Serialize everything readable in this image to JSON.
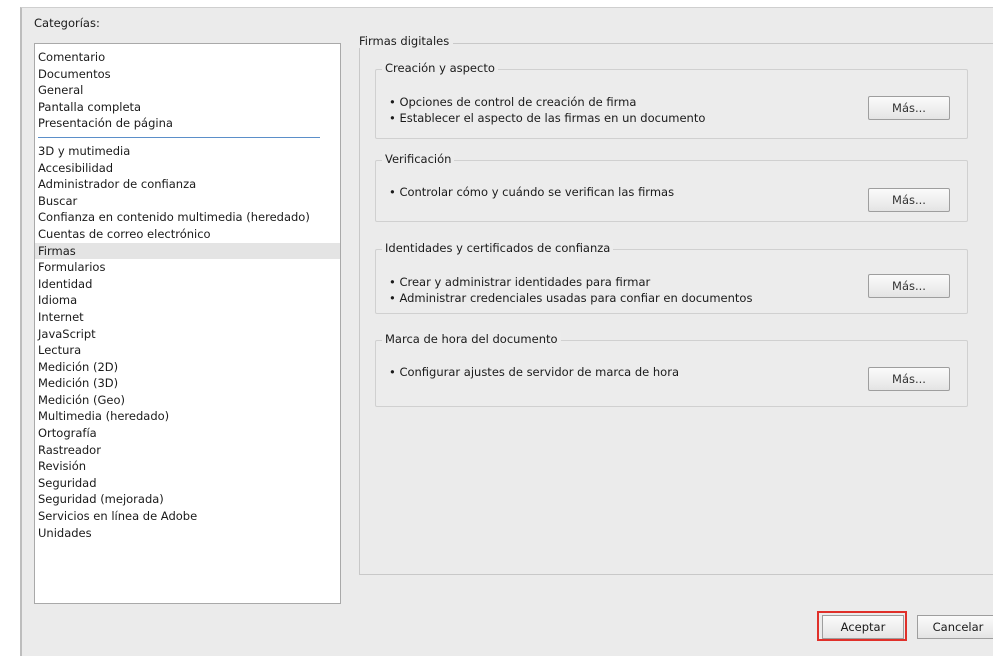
{
  "categories_label": "Categorías:",
  "categories_group1": [
    "Comentario",
    "Documentos",
    "General",
    "Pantalla completa",
    "Presentación de página"
  ],
  "categories_group2": [
    "3D y mutimedia",
    "Accesibilidad",
    "Administrador de confianza",
    "Buscar",
    "Confianza en contenido multimedia (heredado)",
    "Cuentas de correo electrónico",
    "Firmas",
    "Formularios",
    "Identidad",
    "Idioma",
    "Internet",
    "JavaScript",
    "Lectura",
    "Medición (2D)",
    "Medición (3D)",
    "Medición (Geo)",
    "Multimedia (heredado)",
    "Ortografía",
    "Rastreador",
    "Revisión",
    "Seguridad",
    "Seguridad (mejorada)",
    "Servicios en línea de Adobe",
    "Unidades"
  ],
  "selected_category": "Firmas",
  "panel_title": "Firmas digitales",
  "groups": [
    {
      "title": "Creación y aspecto",
      "bullets": [
        "• Opciones de control de creación de firma",
        "• Establecer el aspecto de las firmas en un documento"
      ],
      "button": "Más..."
    },
    {
      "title": "Verificación",
      "bullets": [
        "• Controlar cómo y cuándo se verifican las firmas"
      ],
      "button": "Más..."
    },
    {
      "title": "Identidades y certificados de confianza",
      "bullets": [
        "• Crear y administrar identidades para firmar",
        "• Administrar credenciales usadas para confiar en documentos"
      ],
      "button": "Más..."
    },
    {
      "title": "Marca de hora del documento",
      "bullets": [
        "• Configurar ajustes de servidor de marca de hora"
      ],
      "button": "Más..."
    }
  ],
  "footer": {
    "accept": "Aceptar",
    "cancel": "Cancelar"
  },
  "colors": {
    "highlight": "#e0302a",
    "separator": "#5b8fc9"
  }
}
